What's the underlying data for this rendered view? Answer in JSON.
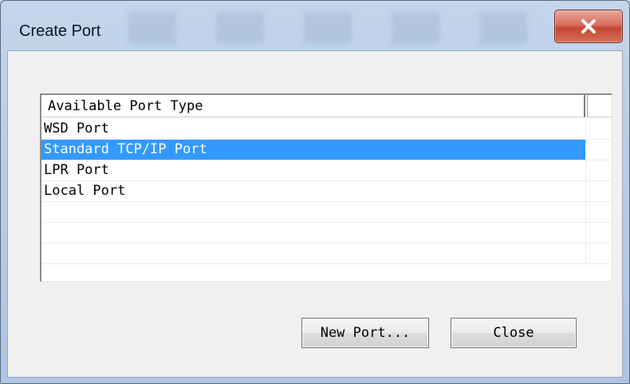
{
  "window": {
    "title": "Create Port",
    "close_glyph": "✕"
  },
  "listview": {
    "column_header": "Available Port Type",
    "items": [
      {
        "label": "WSD Port",
        "selected": false
      },
      {
        "label": "Standard TCP/IP Port",
        "selected": true
      },
      {
        "label": "LPR Port",
        "selected": false
      },
      {
        "label": "Local Port",
        "selected": false
      },
      {
        "label": "",
        "selected": false
      },
      {
        "label": "",
        "selected": false
      },
      {
        "label": "",
        "selected": false
      }
    ]
  },
  "buttons": {
    "new_port_label": "New Port...",
    "close_label": "Close"
  },
  "colors": {
    "selection": "#3399ff",
    "close_button": "#c44632"
  }
}
